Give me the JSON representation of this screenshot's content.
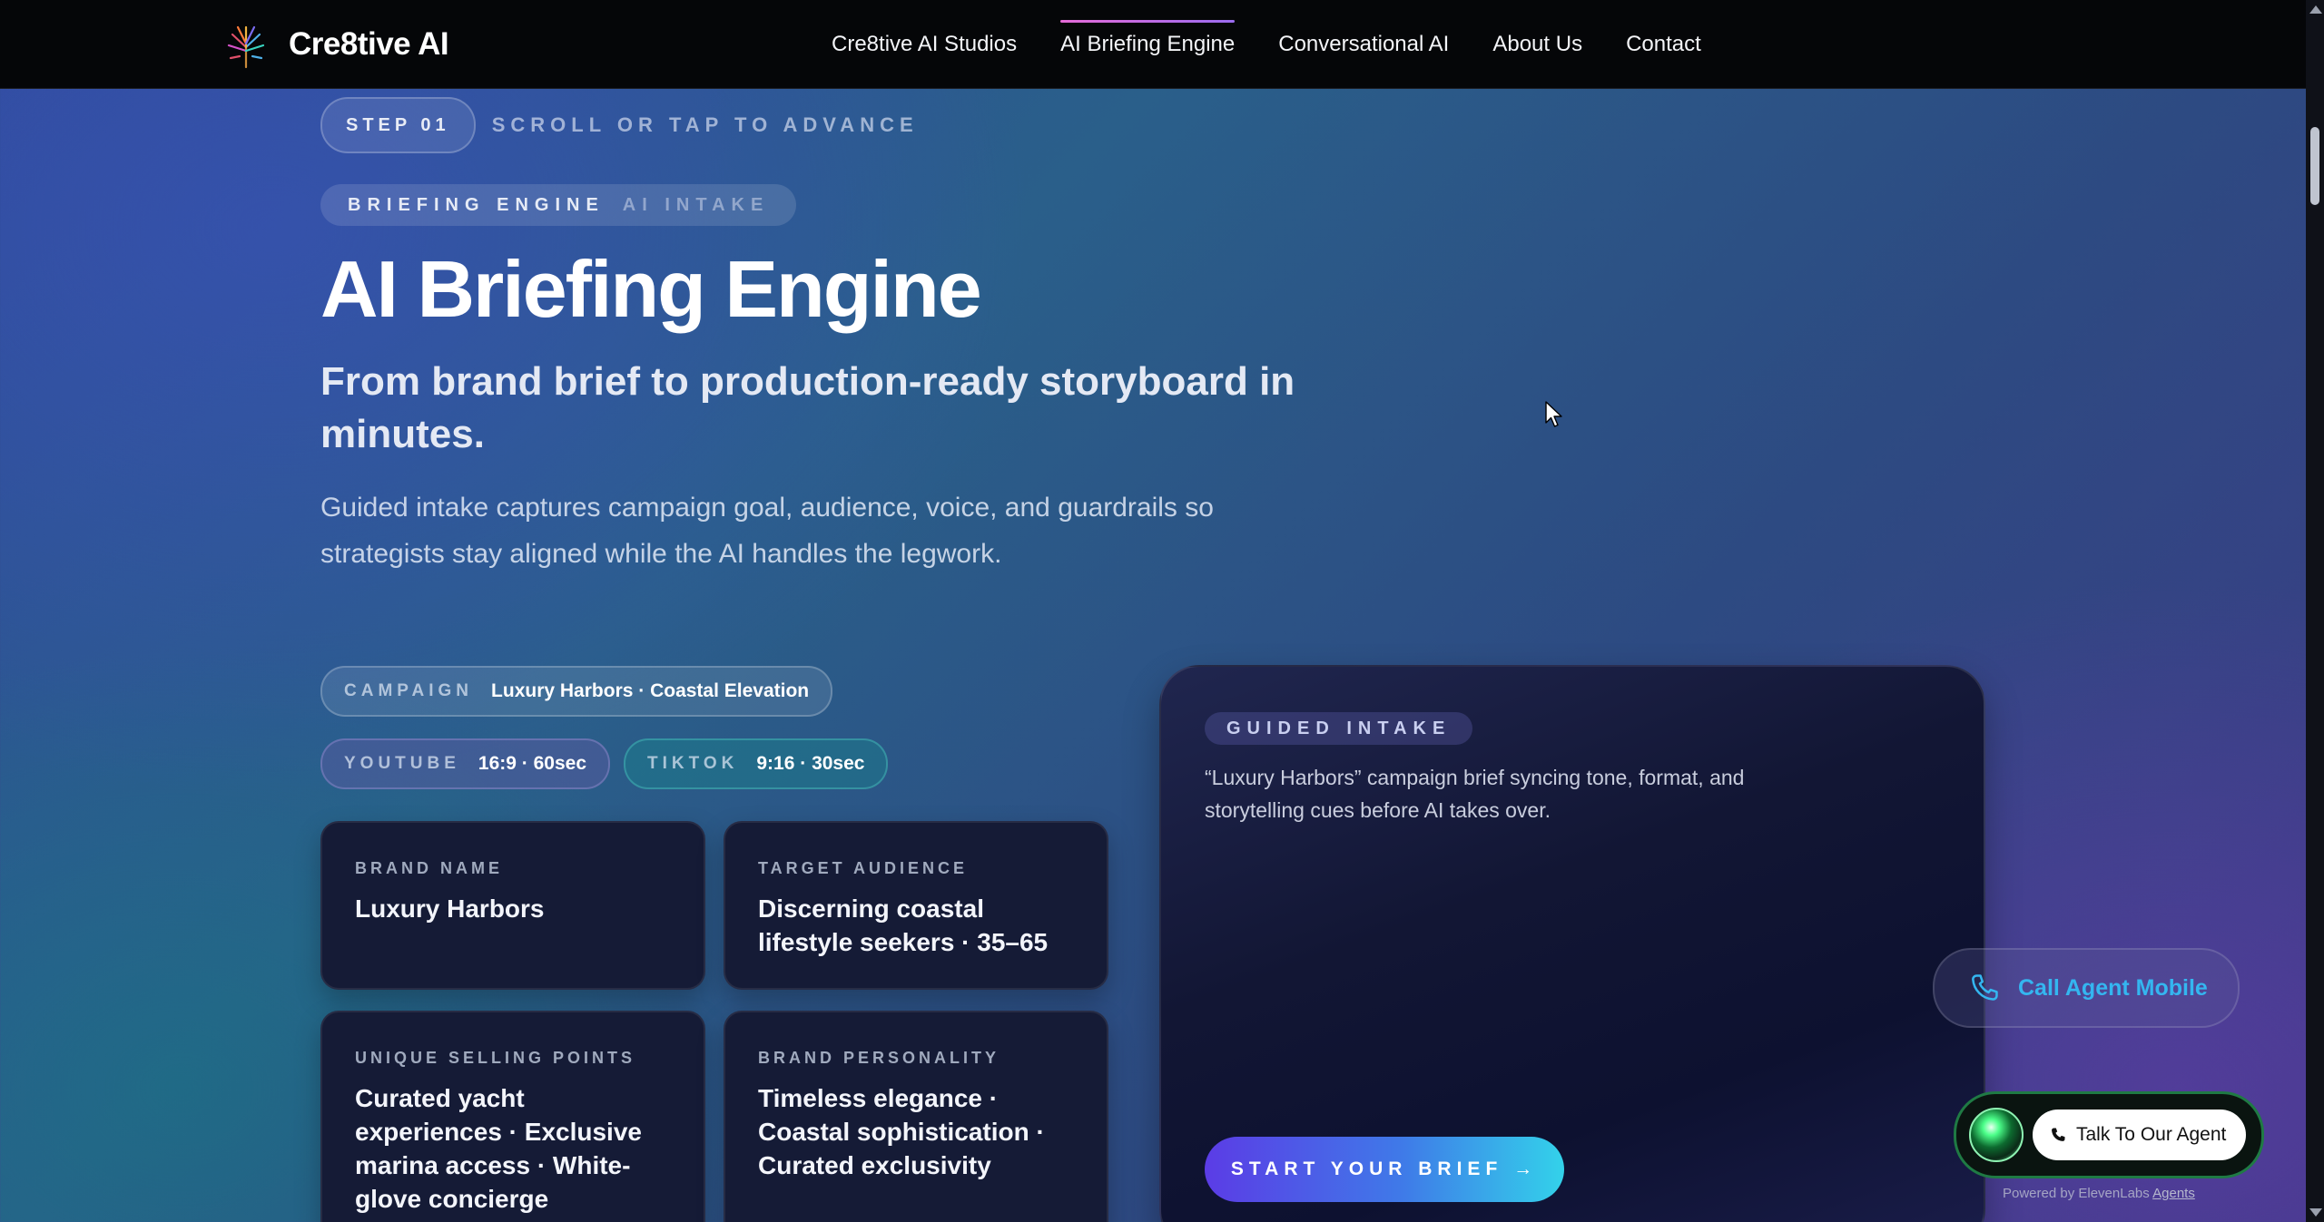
{
  "nav": {
    "brand": "Cre8tive AI",
    "links": [
      {
        "label": "Cre8tive AI Studios",
        "active": false
      },
      {
        "label": "AI Briefing Engine",
        "active": true
      },
      {
        "label": "Conversational AI",
        "active": false
      },
      {
        "label": "About Us",
        "active": false
      },
      {
        "label": "Contact",
        "active": false
      }
    ]
  },
  "hero": {
    "step_label": "STEP 01",
    "step_hint": "SCROLL OR TAP TO ADVANCE",
    "eyebrow_primary": "BRIEFING ENGINE",
    "eyebrow_secondary": "AI INTAKE",
    "title": "AI Briefing Engine",
    "subtitle": "From brand brief to production-ready storyboard in minutes.",
    "body": "Guided intake captures campaign goal, audience, voice, and guardrails so strategists stay aligned while the AI handles the legwork."
  },
  "chips": {
    "campaign": {
      "key": "CAMPAIGN",
      "value": "Luxury Harbors · Coastal Elevation"
    },
    "youtube": {
      "key": "YOUTUBE",
      "value": "16:9 · 60sec"
    },
    "tiktok": {
      "key": "TIKTOK",
      "value": "9:16 · 30sec"
    }
  },
  "cards": {
    "brand_name": {
      "label": "BRAND NAME",
      "value": "Luxury Harbors"
    },
    "target_audience": {
      "label": "TARGET AUDIENCE",
      "value": "Discerning coastal lifestyle seekers · 35–65"
    },
    "unique_selling_points": {
      "label": "UNIQUE SELLING POINTS",
      "value": "Curated yacht experiences · Exclusive marina access · White-glove concierge"
    },
    "brand_personality": {
      "label": "BRAND PERSONALITY",
      "value": "Timeless elegance · Coastal sophistication · Curated exclusivity"
    }
  },
  "intake": {
    "badge": "GUIDED INTAKE",
    "text": "“Luxury Harbors” campaign brief syncing tone, format, and storytelling cues before AI takes over.",
    "cta": "START YOUR BRIEF →"
  },
  "widgets": {
    "call_mobile": "Call Agent Mobile",
    "talk_agent": "Talk To Our Agent",
    "powered_prefix": "Powered by ElevenLabs",
    "powered_link": "Agents"
  },
  "icons": {
    "logo": "tree-logo-icon",
    "phone": "phone-icon",
    "orb": "agent-orb-icon",
    "cursor": "mouse-cursor-icon"
  },
  "colors": {
    "nav_bg": "#050608",
    "accent_pink": "#e56bd8",
    "cta_start": "#5b3ce6",
    "cta_end": "#33d2ea",
    "call_text": "#34b6f0",
    "agent_border": "#1f7a44"
  }
}
